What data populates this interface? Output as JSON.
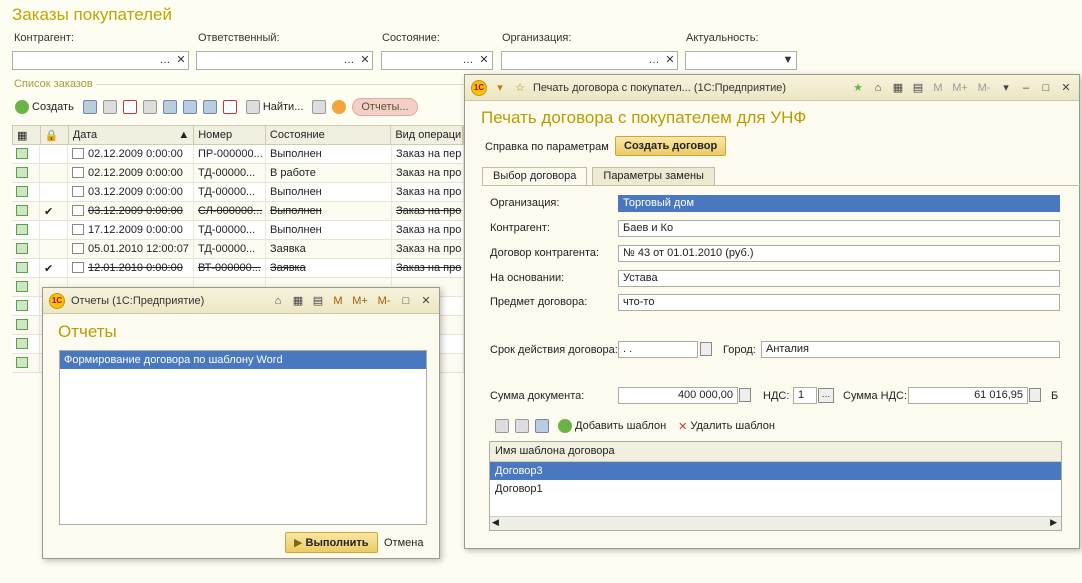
{
  "page": {
    "title": "Заказы покупателей",
    "filters": {
      "counterparty_label": "Контрагент:",
      "responsible_label": "Ответственный:",
      "state_label": "Состояние:",
      "organization_label": "Организация:",
      "relevance_label": "Актуальность:"
    },
    "list_label": "Список заказов",
    "toolbar": {
      "create": "Создать",
      "find": "Найти...",
      "reports": "Отчеты..."
    },
    "table": {
      "headers": [
        "Дата",
        "Номер",
        "Состояние",
        "Вид операци"
      ],
      "rows": [
        {
          "check": "",
          "date": "02.12.2009 0:00:00",
          "number": "ПР-000000...",
          "state": "Выполнен",
          "op": "Заказ на пер"
        },
        {
          "check": "",
          "date": "02.12.2009 0:00:00",
          "number": "ТД-00000...",
          "state": "В работе",
          "op": "Заказ на про"
        },
        {
          "check": "",
          "date": "03.12.2009 0:00:00",
          "number": "ТД-00000...",
          "state": "Выполнен",
          "op": "Заказ на про"
        },
        {
          "check": "✔",
          "date": "03.12.2009 0:00:00",
          "number": "СЛ-000000...",
          "state": "Выполнен",
          "op": "Заказ на про"
        },
        {
          "check": "",
          "date": "17.12.2009 0:00:00",
          "number": "ТД-00000...",
          "state": "Выполнен",
          "op": "Заказ на про"
        },
        {
          "check": "",
          "date": "05.01.2010 12:00:07",
          "number": "ТД-00000...",
          "state": "Заявка",
          "op": "Заказ на про"
        },
        {
          "check": "✔",
          "date": "12.01.2010 0:00:00",
          "number": "ВТ-000000...",
          "state": "Заявка",
          "op": "Заказ на про"
        },
        {
          "check": "",
          "date": "",
          "number": "",
          "state": "",
          "op": ""
        },
        {
          "check": "",
          "date": "",
          "number": "",
          "state": "",
          "op": "пер"
        },
        {
          "check": "",
          "date": "",
          "number": "",
          "state": "",
          "op": "пре"
        },
        {
          "check": "",
          "date": "",
          "number": "",
          "state": "",
          "op": "пре"
        },
        {
          "check": "",
          "date": "",
          "number": "",
          "state": "",
          "op": "про"
        }
      ]
    }
  },
  "reports_window": {
    "title": "Отчеты  (1С:Предприятие)",
    "heading": "Отчеты",
    "items": [
      "Формирование договора по шаблону Word"
    ],
    "execute": "Выполнить",
    "cancel": "Отмена",
    "tb_m": "M",
    "tb_mplus": "M+",
    "tb_mminus": "M-"
  },
  "print_window": {
    "title": "Печать договора с покупател...  (1С:Предприятие)",
    "heading": "Печать договора с покупателем для УНФ",
    "help": "Справка по параметрам",
    "create": "Создать договор",
    "tabs": [
      "Выбор договора",
      "Параметры замены"
    ],
    "fields": {
      "org_label": "Организация:",
      "org_value": "Торговый дом",
      "cp_label": "Контрагент:",
      "cp_value": "Баев и Ко",
      "contract_label": "Договор контрагента:",
      "contract_value": "№ 43 от 01.01.2010 (руб.)",
      "basis_label": "На основании:",
      "basis_value": "Устава",
      "subject_label": "Предмет договора:",
      "subject_value": "что-то",
      "term_label": "Срок действия договора:",
      "term_value": " .  .",
      "city_label": "Город:",
      "city_value": "Анталия",
      "sum_label": "Сумма документа:",
      "sum_value": "400 000,00",
      "vat_label": "НДС:",
      "vat_value": "1",
      "vat_sum_label": "Сумма НДС:",
      "vat_sum_value": "61 016,95",
      "cut_label": "Б"
    },
    "add_template": "Добавить шаблон",
    "delete_template": "Удалить шаблон",
    "templates_header": "Имя шаблона договора",
    "templates": [
      "Договор3",
      "Договор1"
    ],
    "tb_m": "M",
    "tb_mplus": "M+",
    "tb_mminus": "M-"
  }
}
